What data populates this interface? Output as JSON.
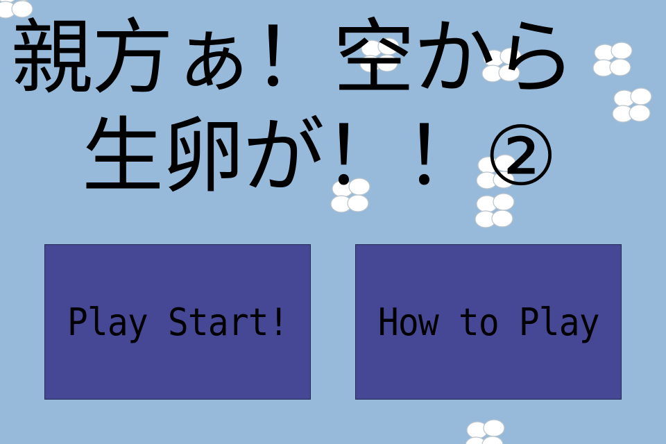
{
  "title": {
    "line1": "親方ぁ！空から",
    "line2": "生卵が！！②"
  },
  "menu": {
    "play_start_label": "Play Start!",
    "how_to_play_label": "How to Play"
  },
  "colors": {
    "background": "#97b9da",
    "button_fill": "#464896",
    "text": "#000000",
    "egg": "#ffffff"
  },
  "icons": {
    "falling_eggs": "egg-cluster-icon"
  }
}
